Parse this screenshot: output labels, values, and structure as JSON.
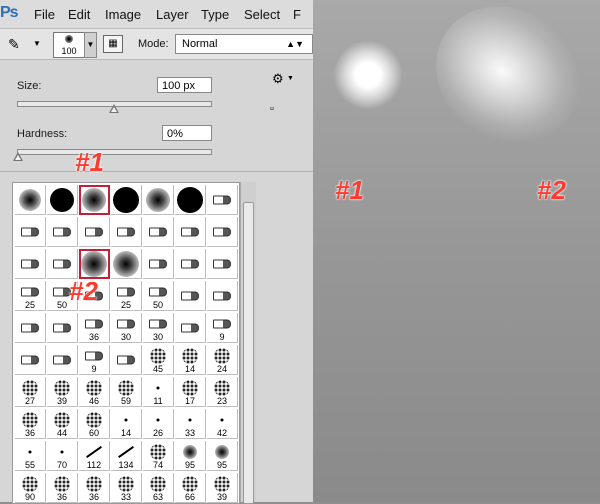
{
  "menu": {
    "logo": "Ps",
    "items": [
      "File",
      "Edit",
      "Image",
      "Layer",
      "Type",
      "Select",
      "F"
    ]
  },
  "options": {
    "preset_size": "100",
    "mode_label": "Mode:",
    "mode_value": "Normal"
  },
  "panel": {
    "size_label": "Size:",
    "size_value": "100 px",
    "size_slider": 0.5,
    "hardness_label": "Hardness:",
    "hardness_value": "0%",
    "hardness_slider": 0.0
  },
  "annotations": {
    "a1": "#1",
    "a2": "#2"
  },
  "brushes": [
    {
      "s": "soft",
      "z": 22
    },
    {
      "s": "hard",
      "z": 24
    },
    {
      "s": "soft",
      "z": 24,
      "sel": true
    },
    {
      "s": "hard",
      "z": 26
    },
    {
      "s": "soft",
      "z": 24
    },
    {
      "s": "hard",
      "z": 26
    },
    {
      "s": "tool"
    },
    {
      "s": "tool"
    },
    {
      "s": "tool"
    },
    {
      "s": "tool"
    },
    {
      "s": "tool"
    },
    {
      "s": "tool"
    },
    {
      "s": "tool"
    },
    {
      "s": "tool"
    },
    {
      "s": "tool"
    },
    {
      "s": "tool"
    },
    {
      "s": "soft",
      "z": 26,
      "sel": true
    },
    {
      "s": "soft",
      "z": 26
    },
    {
      "s": "tool"
    },
    {
      "s": "tool"
    },
    {
      "s": "tool"
    },
    {
      "s": "tool",
      "n": "25"
    },
    {
      "s": "tool",
      "n": "50"
    },
    {
      "s": "tool"
    },
    {
      "s": "tool",
      "n": "25"
    },
    {
      "s": "tool",
      "n": "50"
    },
    {
      "s": "tool"
    },
    {
      "s": "tool"
    },
    {
      "s": "tool"
    },
    {
      "s": "tool"
    },
    {
      "s": "tool",
      "n": "36"
    },
    {
      "s": "tool",
      "n": "30"
    },
    {
      "s": "tool",
      "n": "30"
    },
    {
      "s": "tool"
    },
    {
      "s": "tool",
      "n": "9"
    },
    {
      "s": "tool"
    },
    {
      "s": "tool"
    },
    {
      "s": "tool",
      "n": "9"
    },
    {
      "s": "tool"
    },
    {
      "s": "scatter",
      "n": "45"
    },
    {
      "s": "scatter",
      "n": "14"
    },
    {
      "s": "scatter",
      "n": "24"
    },
    {
      "s": "scatter",
      "n": "27"
    },
    {
      "s": "scatter",
      "n": "39"
    },
    {
      "s": "scatter",
      "n": "46"
    },
    {
      "s": "scatter",
      "n": "59"
    },
    {
      "s": "tiny",
      "n": "11"
    },
    {
      "s": "scatter",
      "n": "17"
    },
    {
      "s": "scatter",
      "n": "23"
    },
    {
      "s": "scatter",
      "n": "36"
    },
    {
      "s": "scatter",
      "n": "44"
    },
    {
      "s": "scatter",
      "n": "60"
    },
    {
      "s": "tiny",
      "n": "14"
    },
    {
      "s": "tiny",
      "n": "26"
    },
    {
      "s": "tiny",
      "n": "33"
    },
    {
      "s": "tiny",
      "n": "42"
    },
    {
      "s": "tiny",
      "n": "55"
    },
    {
      "s": "tiny",
      "n": "70"
    },
    {
      "s": "stroke",
      "n": "112"
    },
    {
      "s": "stroke",
      "n": "134"
    },
    {
      "s": "scatter",
      "n": "74"
    },
    {
      "s": "soft",
      "z": 14,
      "n": "95"
    },
    {
      "s": "soft",
      "z": 14,
      "n": "95"
    },
    {
      "s": "scatter",
      "n": "90"
    },
    {
      "s": "scatter",
      "n": "36"
    },
    {
      "s": "scatter",
      "n": "36"
    },
    {
      "s": "scatter",
      "n": "33"
    },
    {
      "s": "scatter",
      "n": "63"
    },
    {
      "s": "scatter",
      "n": "66"
    },
    {
      "s": "scatter",
      "n": "39"
    }
  ]
}
